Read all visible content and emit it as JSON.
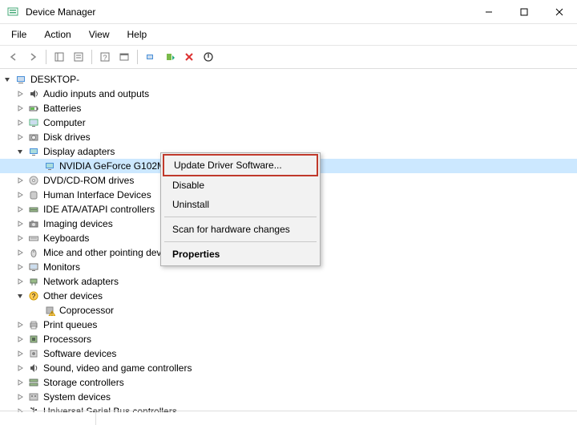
{
  "window": {
    "title": "Device Manager"
  },
  "menubar": [
    "File",
    "Action",
    "View",
    "Help"
  ],
  "root": "DESKTOP-",
  "tree": [
    {
      "label": "Audio inputs and outputs",
      "icon": "audio",
      "state": "closed"
    },
    {
      "label": "Batteries",
      "icon": "battery",
      "state": "closed"
    },
    {
      "label": "Computer",
      "icon": "computer",
      "state": "closed"
    },
    {
      "label": "Disk drives",
      "icon": "disk",
      "state": "closed"
    },
    {
      "label": "Display adapters",
      "icon": "display",
      "state": "open",
      "children": [
        {
          "label": "NVIDIA GeForce G102M",
          "icon": "display",
          "selected": true
        }
      ]
    },
    {
      "label": "DVD/CD-ROM drives",
      "icon": "dvd",
      "state": "closed"
    },
    {
      "label": "Human Interface Devices",
      "icon": "hid",
      "state": "closed"
    },
    {
      "label": "IDE ATA/ATAPI controllers",
      "icon": "ide",
      "state": "closed"
    },
    {
      "label": "Imaging devices",
      "icon": "camera",
      "state": "closed"
    },
    {
      "label": "Keyboards",
      "icon": "keyboard",
      "state": "closed"
    },
    {
      "label": "Mice and other pointing devices",
      "icon": "mouse",
      "state": "closed"
    },
    {
      "label": "Monitors",
      "icon": "monitor",
      "state": "closed"
    },
    {
      "label": "Network adapters",
      "icon": "network",
      "state": "closed"
    },
    {
      "label": "Other devices",
      "icon": "other",
      "state": "open",
      "children": [
        {
          "label": "Coprocessor",
          "icon": "warn"
        }
      ]
    },
    {
      "label": "Print queues",
      "icon": "printer",
      "state": "closed"
    },
    {
      "label": "Processors",
      "icon": "cpu",
      "state": "closed"
    },
    {
      "label": "Software devices",
      "icon": "software",
      "state": "closed"
    },
    {
      "label": "Sound, video and game controllers",
      "icon": "sound",
      "state": "closed"
    },
    {
      "label": "Storage controllers",
      "icon": "storage",
      "state": "closed"
    },
    {
      "label": "System devices",
      "icon": "system",
      "state": "closed"
    },
    {
      "label": "Universal Serial Bus controllers",
      "icon": "usb",
      "state": "closed"
    }
  ],
  "context_menu": [
    {
      "label": "Update Driver Software...",
      "highlight": true
    },
    {
      "label": "Disable"
    },
    {
      "label": "Uninstall"
    },
    {
      "sep": true
    },
    {
      "label": "Scan for hardware changes"
    },
    {
      "sep": true
    },
    {
      "label": "Properties",
      "bold": true
    }
  ]
}
